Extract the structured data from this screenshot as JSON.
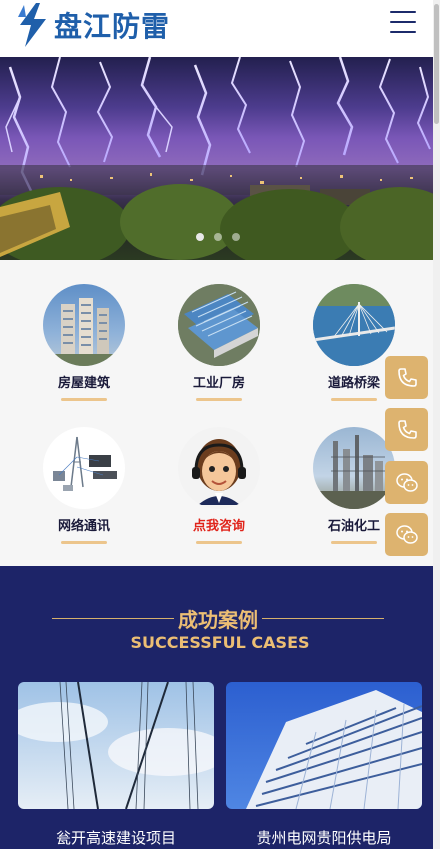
{
  "header": {
    "logo_text": "盘江防雷",
    "menu_icon": "hamburger-menu-icon"
  },
  "banner": {
    "slides_count": 3,
    "active_slide": 1
  },
  "categories": [
    {
      "label": "房屋建筑",
      "icon": "building-icon"
    },
    {
      "label": "工业厂房",
      "icon": "factory-icon"
    },
    {
      "label": "道路桥梁",
      "icon": "bridge-icon"
    },
    {
      "label": "网络通讯",
      "icon": "network-icon"
    },
    {
      "label": "点我咨询",
      "icon": "support-agent-icon"
    },
    {
      "label": "石油化工",
      "icon": "refinery-icon"
    }
  ],
  "float_buttons": [
    {
      "icon": "phone-icon"
    },
    {
      "icon": "phone-icon"
    },
    {
      "icon": "wechat-icon"
    },
    {
      "icon": "wechat-icon"
    }
  ],
  "cases": {
    "title": "成功案例",
    "subtitle": "SUCCESSFUL CASES",
    "items": [
      {
        "label": "瓮开高速建设项目"
      },
      {
        "label": "贵州电网贵阳供电局"
      }
    ]
  },
  "colors": {
    "brand_blue": "#1f5faa",
    "navy": "#1d2468",
    "gold": "#ddb36f",
    "accent_red": "#e0241b"
  }
}
